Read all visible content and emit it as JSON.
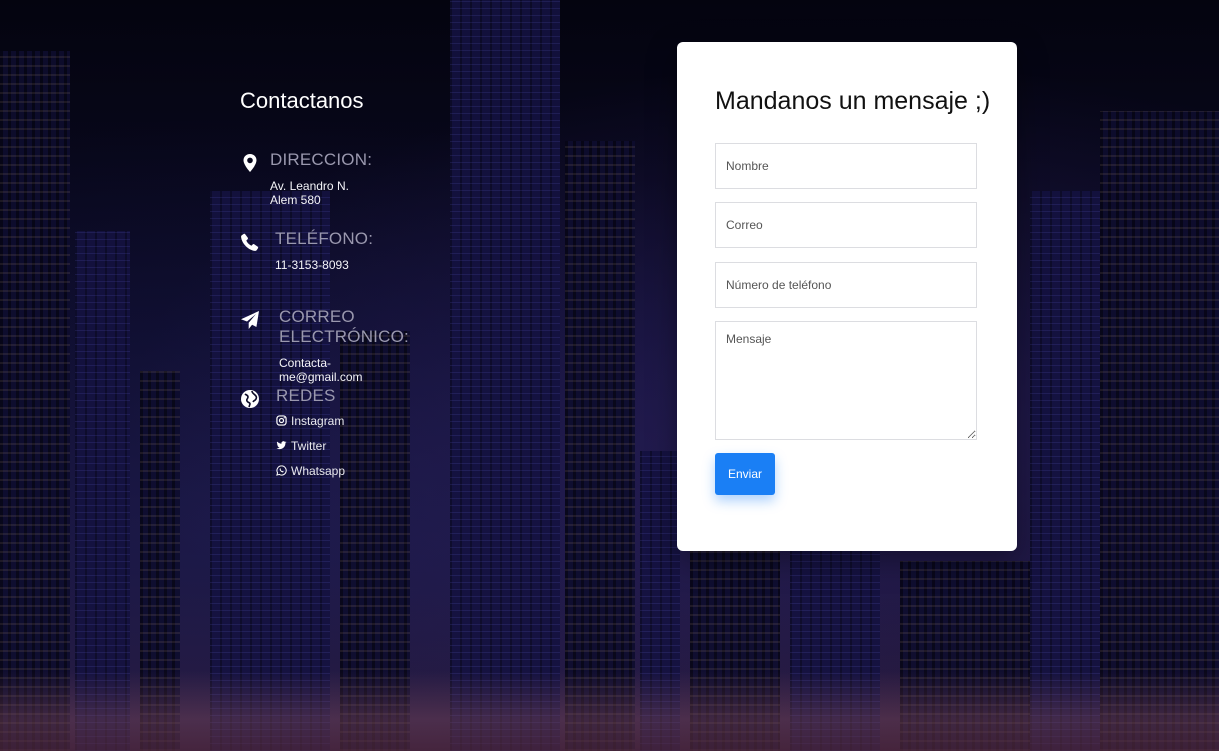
{
  "contact": {
    "title": "Contactanos",
    "address": {
      "label": "DIRECCION:",
      "value": "Av. Leandro N. Alem 580"
    },
    "phone": {
      "label": "TELÉFONO:",
      "value": "11-3153-8093"
    },
    "email": {
      "label": "CORREO ELECTRÓNICO:",
      "value": "Contacta-me@gmail.com"
    },
    "social": {
      "label": "REDES",
      "instagram": "Instagram",
      "twitter": "Twitter",
      "whatsapp": "Whatsapp"
    }
  },
  "form": {
    "title": "Mandanos un mensaje ;)",
    "name_placeholder": "Nombre",
    "email_placeholder": "Correo",
    "phone_placeholder": "Número de teléfono",
    "message_placeholder": "Mensaje",
    "submit_label": "Enviar"
  },
  "icons": [
    "map-pin-icon",
    "phone-icon",
    "paper-plane-icon",
    "globe-icon",
    "instagram-icon",
    "twitter-icon",
    "whatsapp-icon"
  ],
  "colors": {
    "accent": "#1a7ff5",
    "background": "#07061a",
    "label": "#9a98ae"
  }
}
